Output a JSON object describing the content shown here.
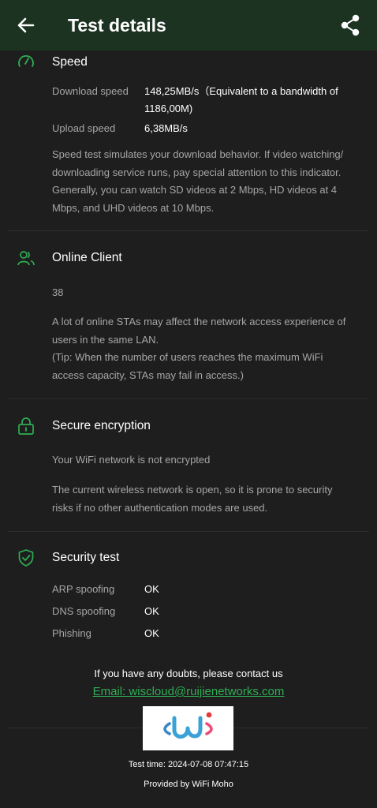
{
  "header": {
    "title": "Test details",
    "back_icon": "arrow-left-icon",
    "share_icon": "share-icon"
  },
  "speed": {
    "title": "Speed",
    "download_label": "Download speed",
    "download_value_line1": "148,25MB/s（Equivalent to a bandwidth of",
    "download_value_line2": "1186,00M)",
    "upload_label": "Upload speed",
    "upload_value": "6,38MB/s",
    "desc_lines": [
      "Speed test simulates your download behavior. If video watching/",
      "downloading service runs, pay special attention to this indicator.",
      "Generally, you can watch SD videos at 2 Mbps, HD videos at 4",
      "Mbps, and UHD videos at 10 Mbps."
    ]
  },
  "online_client": {
    "title": "Online Client",
    "count": "38",
    "desc_lines": [
      "A lot of online STAs may affect the network access experience of",
      "users in the same LAN.",
      "(Tip: When the number of users reaches the maximum WiFi",
      "access capacity, STAs may fail in access.)"
    ]
  },
  "encryption": {
    "title": "Secure encryption",
    "status": "Your WiFi network is not encrypted",
    "desc_lines": [
      "The current wireless network is open, so it is prone to security",
      "risks if no other authentication modes are used."
    ]
  },
  "security_test": {
    "title": "Security test",
    "items": [
      {
        "label": "ARP spoofing",
        "value": "OK"
      },
      {
        "label": "DNS spoofing",
        "value": "OK"
      },
      {
        "label": "Phishing",
        "value": "OK"
      }
    ]
  },
  "contact": {
    "text": "If you have any doubts, please contact us",
    "email": "Email: wiscloud@ruijienetworks.com"
  },
  "footer": {
    "test_time": "Test time: 2024-07-08 07:47:15",
    "provided_by": "Provided by WiFi Moho"
  },
  "colors": {
    "accent": "#2fae53",
    "header_bg": "#1c3322",
    "background": "#1e1e1e"
  }
}
